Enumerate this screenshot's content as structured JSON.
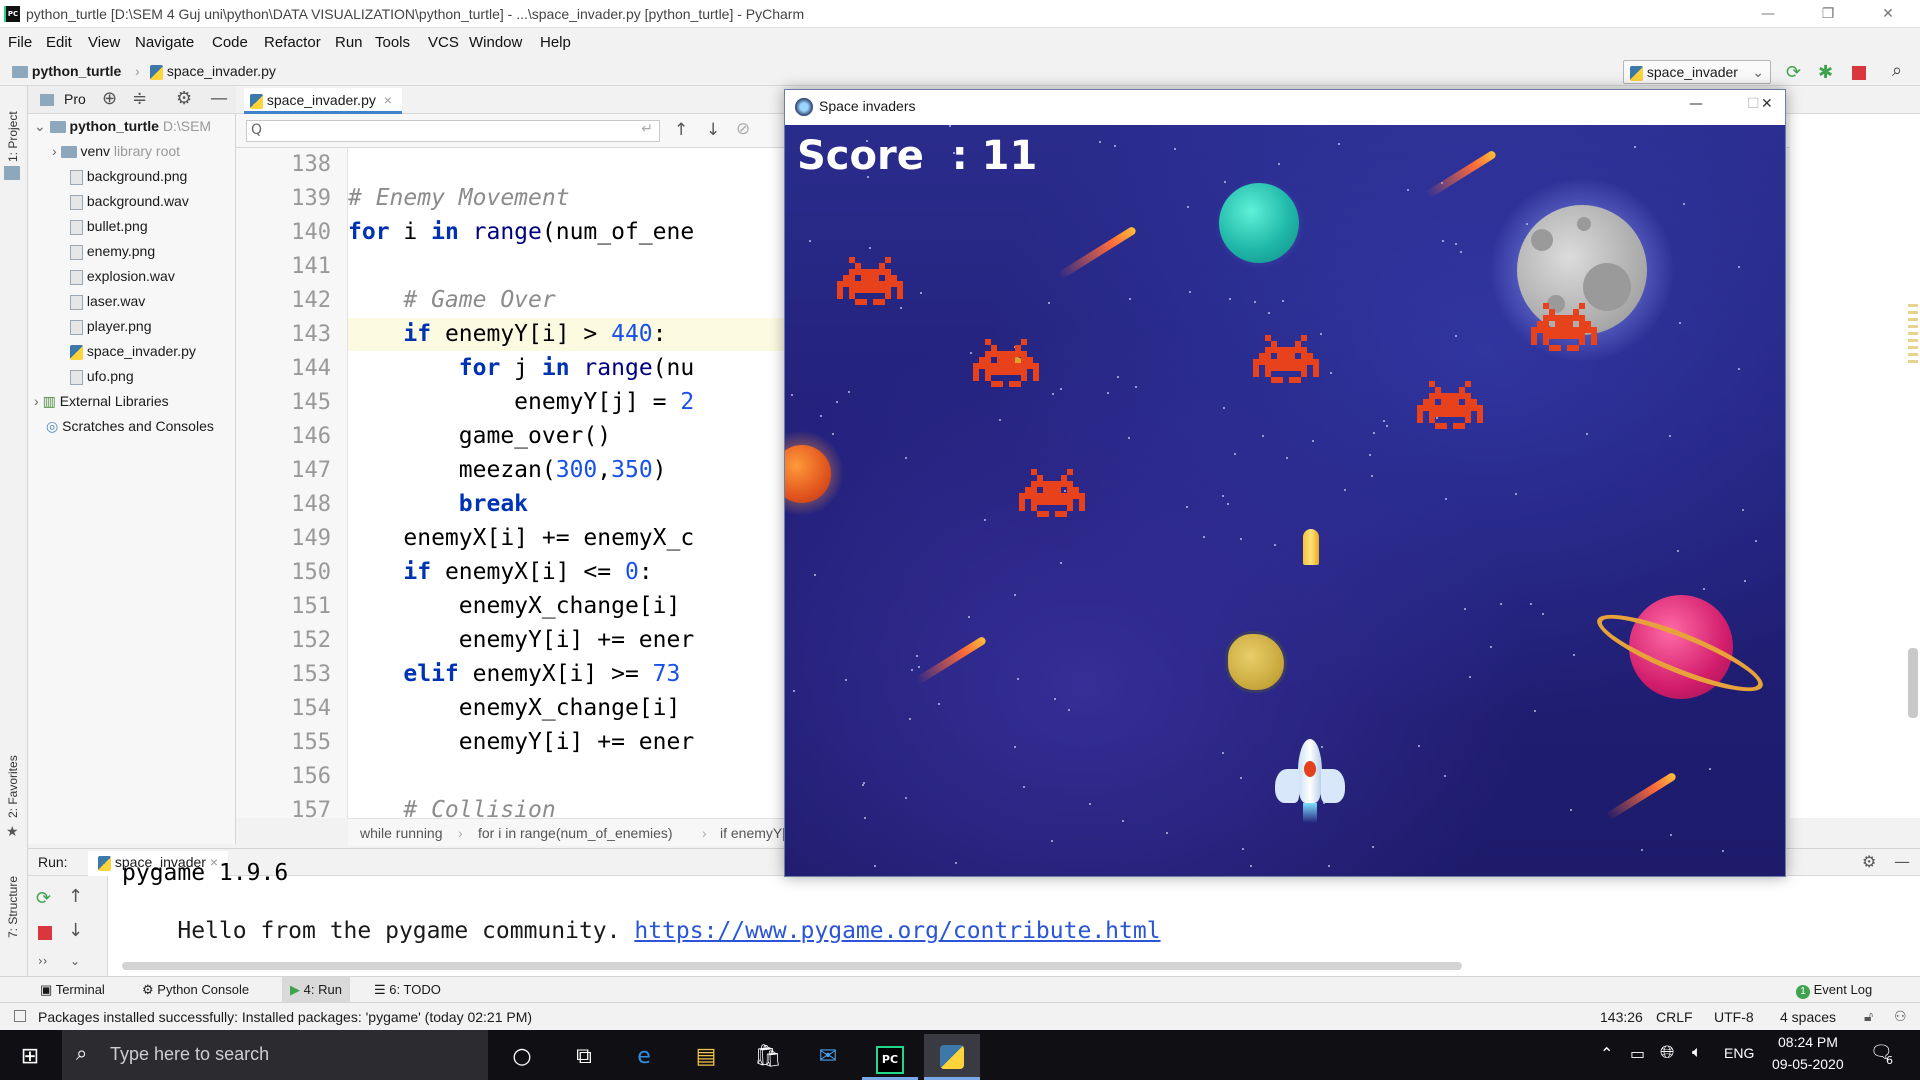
{
  "window": {
    "title": "python_turtle [D:\\SEM 4 Guj uni\\python\\DATA VISUALIZATION\\python_turtle] - ...\\space_invader.py [python_turtle] - PyCharm",
    "logo_text": "PC"
  },
  "menu": [
    "File",
    "Edit",
    "View",
    "Navigate",
    "Code",
    "Refactor",
    "Run",
    "Tools",
    "VCS",
    "Window",
    "Help"
  ],
  "navbar": {
    "project": "python_turtle",
    "file": "space_invader.py",
    "run_config": "space_invader"
  },
  "left_strip": {
    "project_tab": "1: Project",
    "favorites_tab": "2: Favorites",
    "structure_tab": "7: Structure"
  },
  "project_panel": {
    "header": "Pro",
    "root": "python_turtle",
    "root_path": "D:\\SEM",
    "items": [
      {
        "name": "venv",
        "note": "library root",
        "type": "folder"
      },
      {
        "name": "background.png",
        "type": "image"
      },
      {
        "name": "background.wav",
        "type": "image"
      },
      {
        "name": "bullet.png",
        "type": "image"
      },
      {
        "name": "enemy.png",
        "type": "image"
      },
      {
        "name": "explosion.wav",
        "type": "image"
      },
      {
        "name": "laser.wav",
        "type": "image"
      },
      {
        "name": "player.png",
        "type": "image"
      },
      {
        "name": "space_invader.py",
        "type": "python"
      },
      {
        "name": "ufo.png",
        "type": "image"
      }
    ],
    "external": "External Libraries",
    "scratches": "Scratches and Consoles"
  },
  "editor": {
    "tab": "space_invader.py",
    "search_placeholder": "Q",
    "line_numbers": [
      "138",
      "139",
      "140",
      "141",
      "142",
      "143",
      "144",
      "145",
      "146",
      "147",
      "148",
      "149",
      "150",
      "151",
      "152",
      "153",
      "154",
      "155",
      "156",
      "157"
    ],
    "breadcrumbs": [
      "while running",
      "for i in range(num_of_enemies)",
      "if enemyY["
    ]
  },
  "run": {
    "label": "Run:",
    "config": "space_invader",
    "partial_line": "pygame 1.9.6",
    "hello_text": "Hello from the pygame community. ",
    "link": "https://www.pygame.org/contribute.html"
  },
  "bottom_tabs": [
    "Terminal",
    "Python Console",
    "4: Run",
    "6: TODO"
  ],
  "event_log": "Event Log",
  "event_log_count": "1",
  "status": {
    "message": "Packages installed successfully: Installed packages: 'pygame' (today 02:21 PM)",
    "position": "143:26",
    "line_sep": "CRLF",
    "encoding": "UTF-8",
    "indent": "4 spaces"
  },
  "game": {
    "title": "Space invaders",
    "score_label": "Score",
    "score_value": "11"
  },
  "taskbar": {
    "search_placeholder": "Type here to search",
    "language": "ENG",
    "time": "08:24 PM",
    "date": "09-05-2020",
    "notification_count": "6"
  },
  "colors": {
    "accent": "#4083c9",
    "space_bg": "#22207a",
    "invader": "#e8421d"
  }
}
